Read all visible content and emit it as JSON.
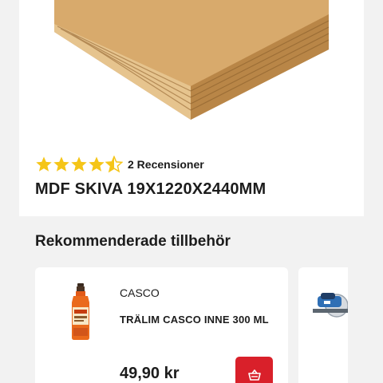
{
  "product": {
    "rating": 4.5,
    "rating_max": 5,
    "review_count": "2 Recensioner",
    "title": "MDF SKIVA 19X1220X2440MM"
  },
  "accessories": {
    "section_title": "Rekommenderade tillbehör",
    "items": [
      {
        "brand": "CASCO",
        "name": "TRÄLIM CASCO INNE 300 ML",
        "price": "49,90 kr",
        "icon": "basket-icon"
      }
    ]
  },
  "colors": {
    "accent": "#d9202a",
    "star": "#f5c518",
    "background": "#f2f2f2"
  }
}
